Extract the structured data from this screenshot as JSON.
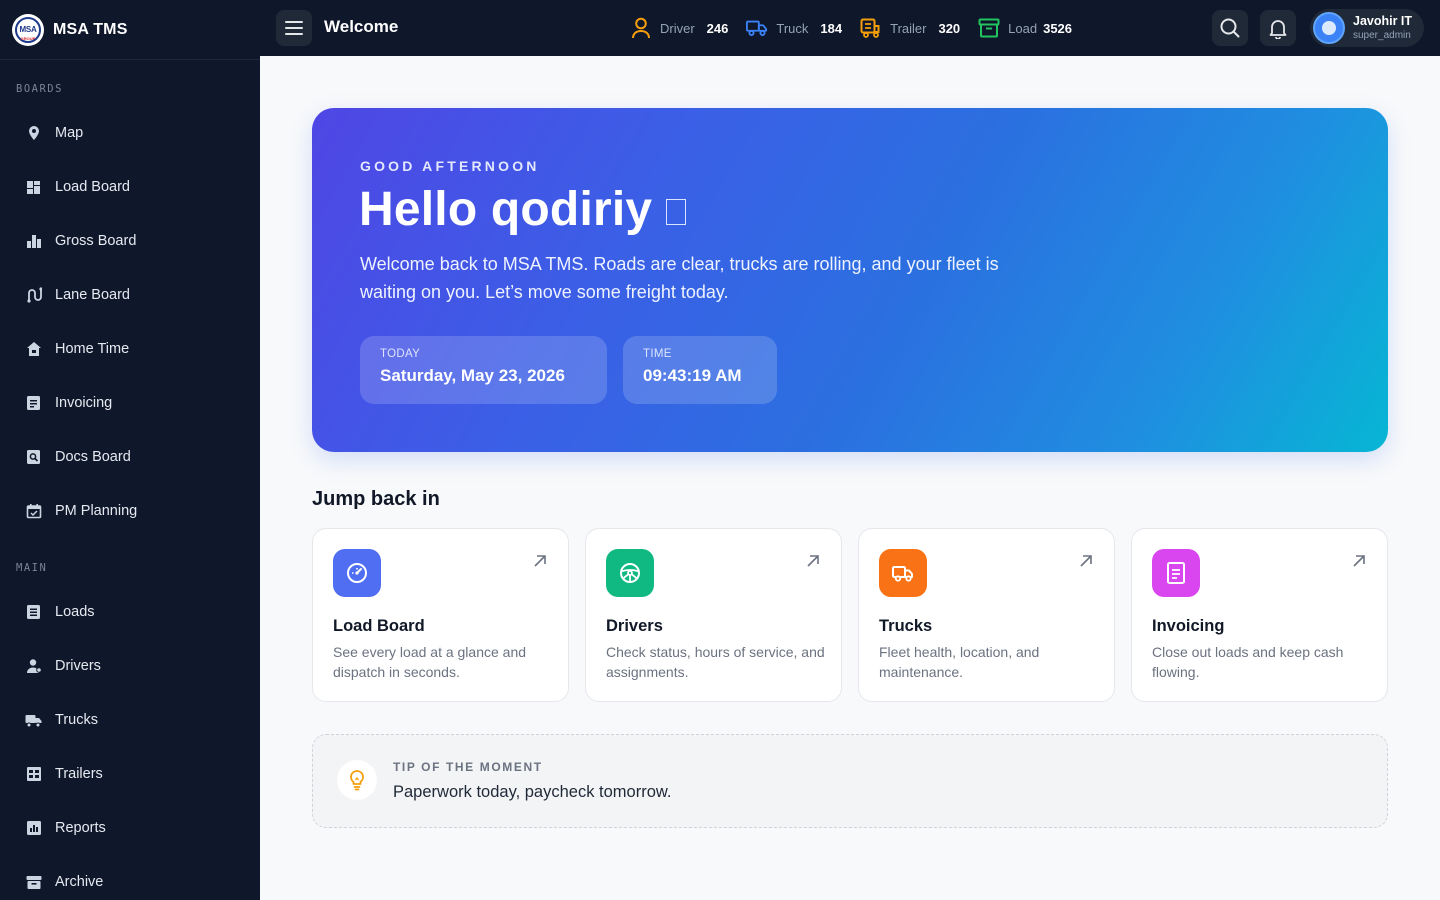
{
  "brand": {
    "logo_text": "MSA",
    "logo_sub": "GROUP",
    "name": "MSA TMS"
  },
  "sidebar": {
    "sections": [
      {
        "label": "BOARDS",
        "items": [
          {
            "label": "Map",
            "icon": "map-pin-icon"
          },
          {
            "label": "Load Board",
            "icon": "dashboard-icon"
          },
          {
            "label": "Gross Board",
            "icon": "bar-chart-icon"
          },
          {
            "label": "Lane Board",
            "icon": "route-icon"
          },
          {
            "label": "Home Time",
            "icon": "home-icon"
          },
          {
            "label": "Invoicing",
            "icon": "document-icon"
          },
          {
            "label": "Docs Board",
            "icon": "file-search-icon"
          },
          {
            "label": "PM Planning",
            "icon": "calendar-check-icon"
          }
        ]
      },
      {
        "label": "MAIN",
        "items": [
          {
            "label": "Loads",
            "icon": "list-icon"
          },
          {
            "label": "Drivers",
            "icon": "person-icon"
          },
          {
            "label": "Trucks",
            "icon": "truck-icon"
          },
          {
            "label": "Trailers",
            "icon": "trailer-icon"
          },
          {
            "label": "Reports",
            "icon": "report-icon"
          },
          {
            "label": "Archive",
            "icon": "archive-icon"
          }
        ]
      }
    ]
  },
  "topbar": {
    "title": "Welcome",
    "stats": [
      {
        "label": "Driver",
        "value": "246",
        "icon": "driver-icon",
        "color": "#f59e0b"
      },
      {
        "label": "Truck",
        "value": "184",
        "icon": "truck-icon",
        "color": "#3b82f6"
      },
      {
        "label": "Trailer",
        "value": "320",
        "icon": "trailer-icon",
        "color": "#f59e0b"
      },
      {
        "label": "Load",
        "value": "3526",
        "icon": "box-icon",
        "color": "#22c55e"
      }
    ],
    "user": {
      "name": "Javohir IT",
      "role": "super_admin"
    }
  },
  "hero": {
    "greeting": "GOOD AFTERNOON",
    "hello": "Hello qodiriy",
    "description": "Welcome back to MSA TMS. Roads are clear, trucks are rolling, and your fleet is waiting on you. Let’s move some freight today.",
    "today_label": "TODAY",
    "today_value": "Saturday, May 23, 2026",
    "time_label": "TIME",
    "time_value": "09:43:19 AM"
  },
  "jump": {
    "title": "Jump back in",
    "cards": [
      {
        "title": "Load Board",
        "desc": "See every load at a glance and dispatch in seconds.",
        "icon": "gauge-icon",
        "color": "#4f6ef2"
      },
      {
        "title": "Drivers",
        "desc": "Check status, hours of service, and assignments.",
        "icon": "steering-wheel-icon",
        "color": "#10b981"
      },
      {
        "title": "Trucks",
        "desc": "Fleet health, location, and maintenance.",
        "icon": "truck-icon",
        "color": "#f97316"
      },
      {
        "title": "Invoicing",
        "desc": "Close out loads and keep cash flowing.",
        "icon": "invoice-icon",
        "color": "#d946ef"
      }
    ]
  },
  "tip": {
    "label": "TIP OF THE MOMENT",
    "text": "Paperwork today, paycheck tomorrow."
  }
}
